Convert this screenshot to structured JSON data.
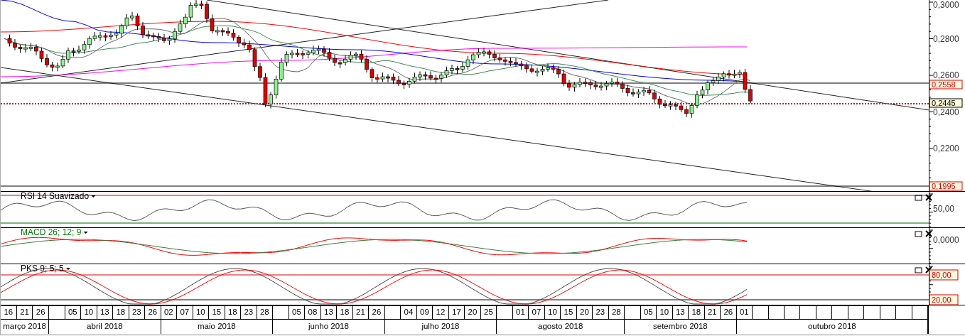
{
  "price_panel": {
    "axis_labels": [
      "0,3000",
      "0,2800",
      "0,2600",
      "0,2400",
      "0,2200"
    ],
    "price_tags": [
      {
        "text": "0,2558",
        "kind": "level"
      },
      {
        "text": "0,2445",
        "kind": "last"
      },
      {
        "text": "0,1995",
        "kind": "level"
      }
    ]
  },
  "indicators": [
    {
      "label": "RSI 14 Suavizado",
      "kind": "rsi",
      "color": "#000000",
      "axis_labels": [
        "50,00"
      ]
    },
    {
      "label": "MACD 26; 12; 9",
      "kind": "macd",
      "color": "#008000",
      "axis_labels": [
        "0,0000"
      ]
    },
    {
      "label": "PKS 9; 5; 5",
      "kind": "pks",
      "color": "#000000",
      "tags": [
        "80,00",
        "20,00"
      ]
    }
  ],
  "timeline": {
    "months": [
      {
        "name": "março 2018",
        "leading_blank": false,
        "days": [
          "16",
          "21",
          "26"
        ]
      },
      {
        "name": "abril 2018",
        "leading_blank": true,
        "days": [
          "05",
          "10",
          "13",
          "18",
          "23",
          "26"
        ]
      },
      {
        "name": "maio 2018",
        "leading_blank": false,
        "days": [
          "02",
          "07",
          "10",
          "15",
          "18",
          "23",
          "28"
        ]
      },
      {
        "name": "junho 2018",
        "leading_blank": true,
        "days": [
          "05",
          "08",
          "13",
          "18",
          "21",
          "26"
        ]
      },
      {
        "name": "julho 2018",
        "leading_blank": true,
        "days": [
          "04",
          "09",
          "12",
          "17",
          "20",
          "25"
        ]
      },
      {
        "name": "agosto 2018",
        "leading_blank": true,
        "days": [
          "01",
          "07",
          "10",
          "15",
          "20",
          "23",
          "28"
        ]
      },
      {
        "name": "setembro 2018",
        "leading_blank": true,
        "days": [
          "05",
          "10",
          "13",
          "18",
          "21",
          "26"
        ]
      },
      {
        "name": "outubro 2018",
        "leading_blank": false,
        "days": [
          "01"
        ]
      }
    ]
  }
}
